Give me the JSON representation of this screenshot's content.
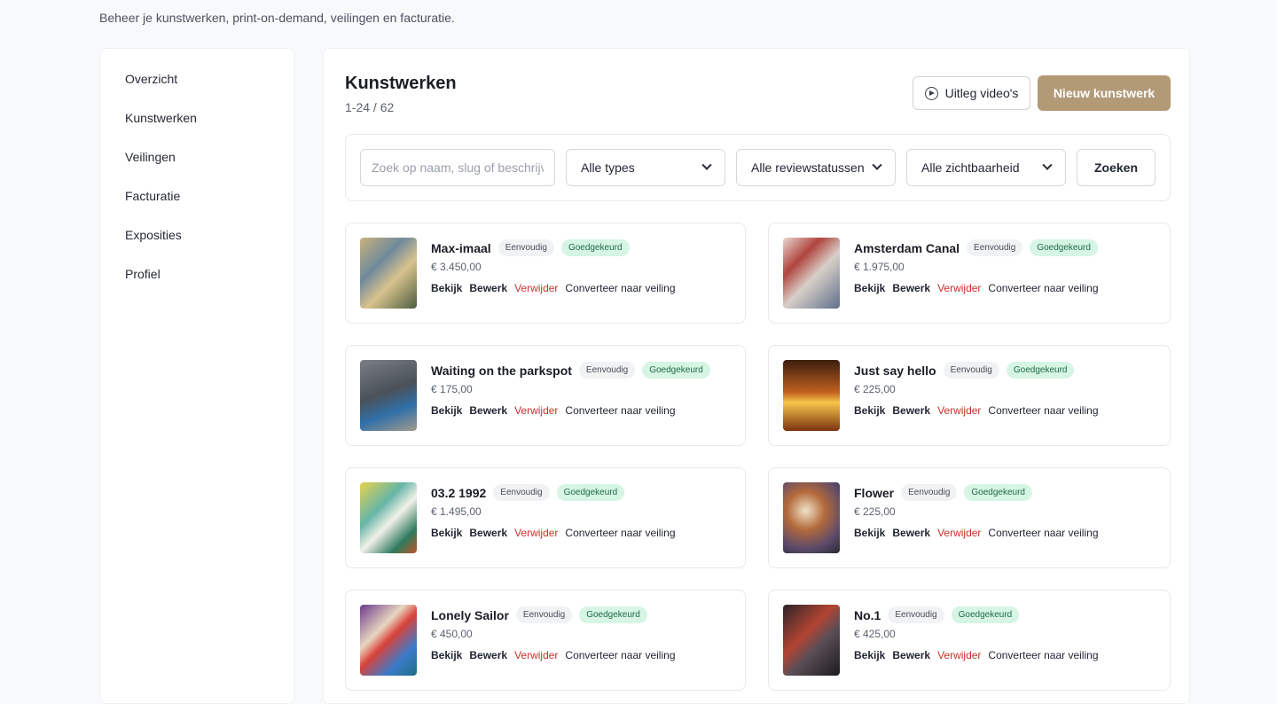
{
  "header": {
    "subtitle": "Beheer je kunstwerken, print-on-demand, veilingen en facturatie."
  },
  "sidebar": {
    "items": [
      {
        "label": "Overzicht"
      },
      {
        "label": "Kunstwerken"
      },
      {
        "label": "Veilingen"
      },
      {
        "label": "Facturatie"
      },
      {
        "label": "Exposities"
      },
      {
        "label": "Profiel"
      }
    ]
  },
  "main": {
    "title": "Kunstwerken",
    "count": "1-24 / 62",
    "video_button": "Uitleg video's",
    "new_button": "Nieuw kunstwerk"
  },
  "filters": {
    "search_placeholder": "Zoek op naam, slug of beschrijving",
    "type_select": "Alle types",
    "review_select": "Alle reviewstatussen",
    "visibility_select": "Alle zichtbaarheid",
    "search_button": "Zoeken"
  },
  "actions": {
    "view": "Bekijk",
    "edit": "Bewerk",
    "delete": "Verwijder",
    "convert": "Converteer naar veiling"
  },
  "colors": {
    "accent": "#b39a77",
    "approved_bg": "#d6f5e4",
    "delete": "#c8312b"
  },
  "artworks": [
    {
      "name": "Max-imaal",
      "type": "Eenvoudig",
      "status": "Goedgekeurd",
      "price": "€ 3.450,00"
    },
    {
      "name": "Amsterdam Canal",
      "type": "Eenvoudig",
      "status": "Goedgekeurd",
      "price": "€ 1.975,00"
    },
    {
      "name": "Waiting on the parkspot",
      "type": "Eenvoudig",
      "status": "Goedgekeurd",
      "price": "€ 175,00"
    },
    {
      "name": "Just say hello",
      "type": "Eenvoudig",
      "status": "Goedgekeurd",
      "price": "€ 225,00"
    },
    {
      "name": "03.2 1992",
      "type": "Eenvoudig",
      "status": "Goedgekeurd",
      "price": "€ 1.495,00"
    },
    {
      "name": "Flower",
      "type": "Eenvoudig",
      "status": "Goedgekeurd",
      "price": "€ 225,00"
    },
    {
      "name": "Lonely Sailor",
      "type": "Eenvoudig",
      "status": "Goedgekeurd",
      "price": "€ 450,00"
    },
    {
      "name": "No.1",
      "type": "Eenvoudig",
      "status": "Goedgekeurd",
      "price": "€ 425,00"
    }
  ]
}
